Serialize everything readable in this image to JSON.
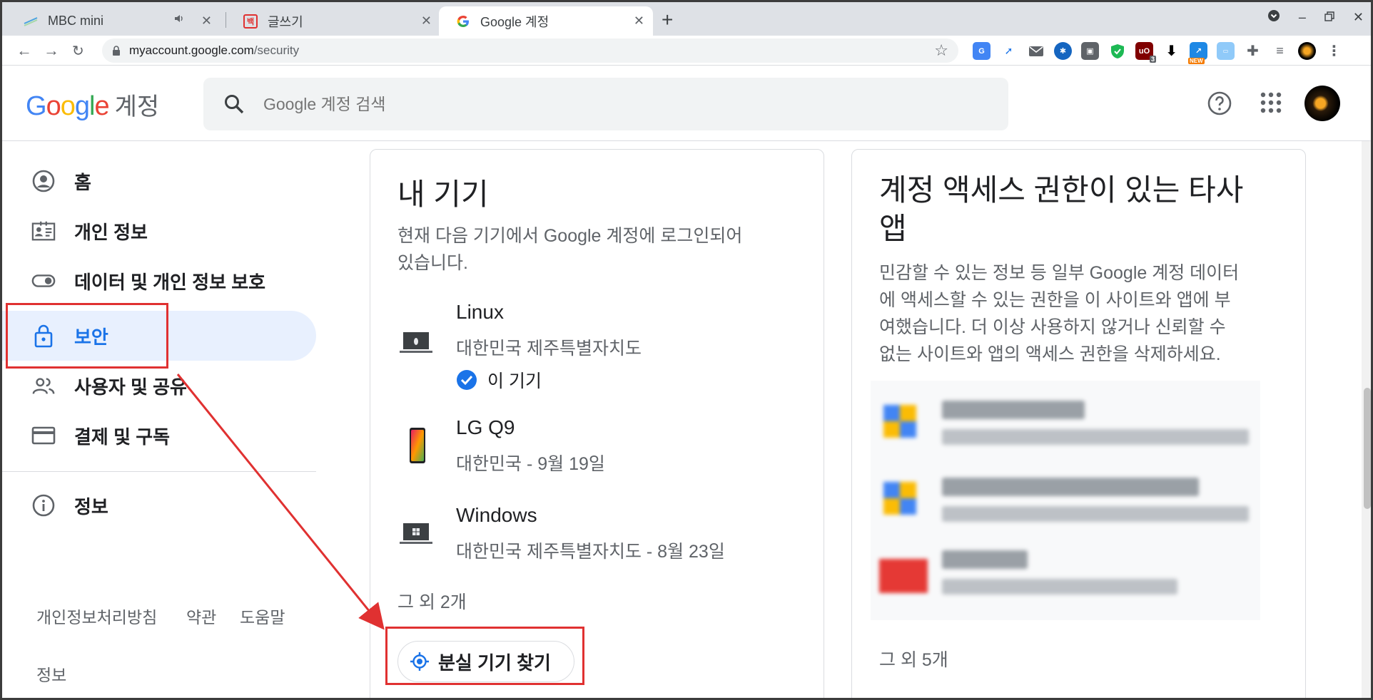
{
  "tabs": [
    {
      "title": "MBC mini",
      "icon": "mbc-icon",
      "audio": true
    },
    {
      "title": "글쓰기",
      "icon": "blog-write-icon",
      "fav_text": "백"
    },
    {
      "title": "Google 계정",
      "icon": "google-g-icon",
      "active": true
    }
  ],
  "url": {
    "host": "myaccount.google.com",
    "path": "/security"
  },
  "extensions": {
    "badge_ublock": "3",
    "badge_new": "NEW"
  },
  "header": {
    "logo_word": "Google",
    "logo_suffix": "계정",
    "search_placeholder": "Google 계정 검색"
  },
  "sidebar": {
    "items": [
      {
        "label": "홈",
        "icon": "home-account-icon"
      },
      {
        "label": "개인 정보",
        "icon": "id-card-icon"
      },
      {
        "label": "데이터 및 개인 정보 보호",
        "icon": "toggle-icon"
      },
      {
        "label": "보안",
        "icon": "lock-icon",
        "active": true
      },
      {
        "label": "사용자 및 공유",
        "icon": "people-icon"
      },
      {
        "label": "결제 및 구독",
        "icon": "credit-card-icon"
      },
      {
        "label": "정보",
        "icon": "info-icon"
      }
    ],
    "footer": [
      "개인정보처리방침",
      "약관",
      "도움말",
      "정보"
    ]
  },
  "devices_card": {
    "title": "내 기기",
    "desc_line1": "현재 다음 기기에서 Google 계정에 로그인되어",
    "desc_line2": "있습니다.",
    "devices": [
      {
        "name": "Linux",
        "location": "대한민국 제주특별자치도",
        "current_label": "이 기기",
        "icon": "laptop-linux-icon"
      },
      {
        "name": "LG Q9",
        "location": "대한민국 - 9월 19일",
        "icon": "phone-icon"
      },
      {
        "name": "Windows",
        "location": "대한민국 제주특별자치도 - 8월 23일",
        "icon": "laptop-windows-icon"
      }
    ],
    "more": "그 외 2개",
    "find_button": "분실 기기 찾기"
  },
  "apps_card": {
    "title_line1": "계정 액세스 권한이 있는 타사",
    "title_line2": "앱",
    "desc": [
      "민감할 수 있는 정보 등 일부 Google 계정 데이터",
      "에 액세스할 수 있는 권한을 이 사이트와 앱에 부",
      "여했습니다. 더 이상 사용하지 않거나 신뢰할 수",
      "없는 사이트와 앱의 액세스 권한을 삭제하세요."
    ],
    "more": "그 외 5개"
  },
  "colors": {
    "accent": "#1a73e8",
    "active_nav_bg": "#e8f0fe",
    "annotation_red": "#e03131"
  }
}
